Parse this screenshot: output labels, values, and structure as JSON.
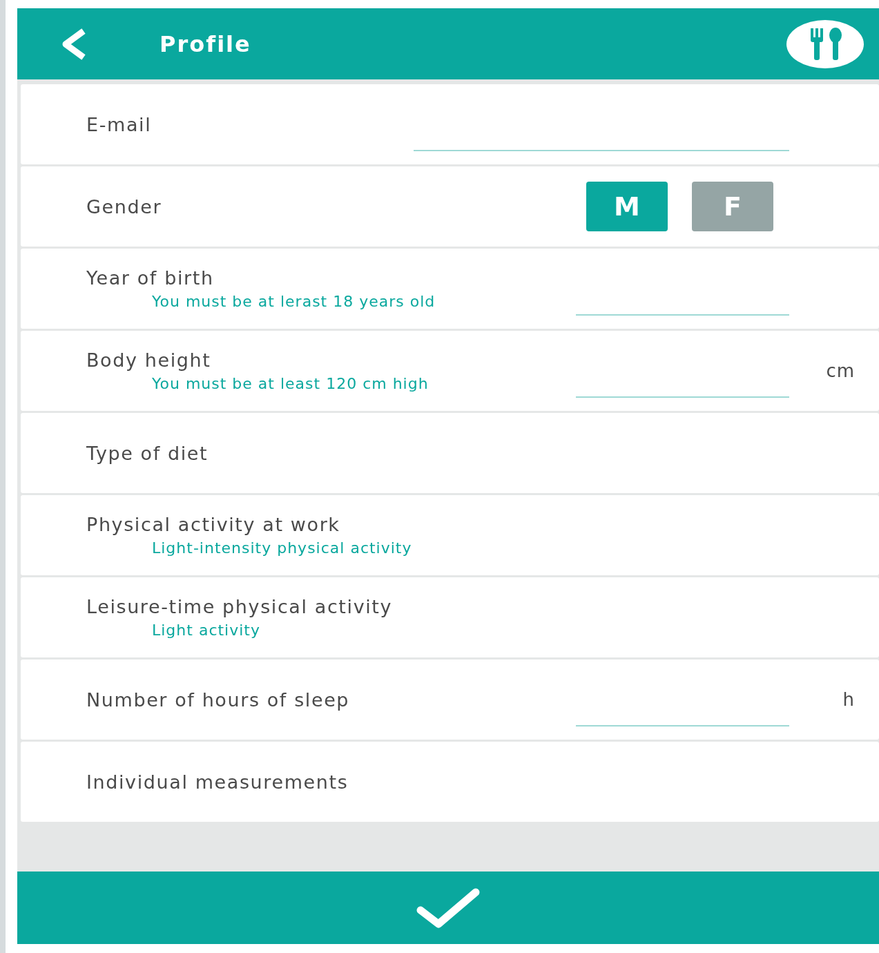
{
  "header": {
    "title": "Profile"
  },
  "rows": [
    {
      "kind": "field",
      "label": "E-mail"
    },
    {
      "kind": "gender",
      "label": "Gender",
      "options": [
        {
          "label": "M",
          "selected": true
        },
        {
          "label": "F",
          "selected": false
        }
      ]
    },
    {
      "kind": "field",
      "label": "Year of birth",
      "hint": "You must be at lerast 18 years old"
    },
    {
      "kind": "field",
      "label": "Body height",
      "hint": "You must be at least 120 cm high",
      "unit": "cm"
    },
    {
      "kind": "link",
      "label": "Type of diet"
    },
    {
      "kind": "link",
      "label": "Physical activity at work",
      "value": "Light-intensity physical activity"
    },
    {
      "kind": "link",
      "label": "Leisure-time physical activity",
      "value": "Light activity"
    },
    {
      "kind": "field",
      "label": "Number of hours of sleep",
      "unit": "h"
    },
    {
      "kind": "link",
      "label": "Individual measurements"
    }
  ]
}
